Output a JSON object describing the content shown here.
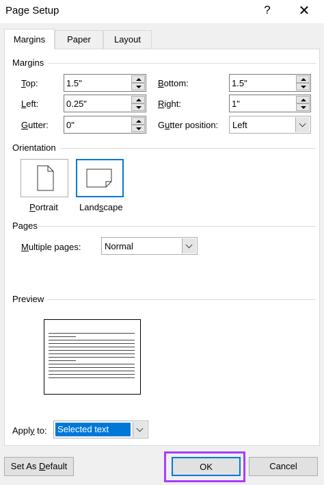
{
  "window": {
    "title": "Page Setup",
    "help": "?",
    "close": "✕"
  },
  "tabs": [
    {
      "label": "Margins",
      "active": true
    },
    {
      "label": "Paper",
      "active": false
    },
    {
      "label": "Layout",
      "active": false
    }
  ],
  "margins": {
    "header": "Margins",
    "top": {
      "label_u": "T",
      "label_rest": "op:",
      "value": "1.5\""
    },
    "left": {
      "label_u": "L",
      "label_rest": "eft:",
      "value": "0.25\""
    },
    "gutter": {
      "label_u": "G",
      "label_rest": "utter:",
      "value": "0\""
    },
    "bottom": {
      "label_u": "B",
      "label_rest": "ottom:",
      "value": "1.5\""
    },
    "right": {
      "label_u": "R",
      "label_rest": "ight:",
      "value": "1\""
    },
    "gutter_position": {
      "label_pre": "G",
      "label_u": "u",
      "label_rest": "tter position:",
      "value": "Left"
    }
  },
  "orientation": {
    "header": "Orientation",
    "portrait": {
      "label_u": "P",
      "label_rest": "ortrait"
    },
    "landscape": {
      "label_pre": "Land",
      "label_u": "s",
      "label_rest": "cape",
      "selected": true
    }
  },
  "pages": {
    "header": "Pages",
    "multiple_pages": {
      "label_u": "M",
      "label_rest": "ultiple pages:",
      "value": "Normal"
    }
  },
  "preview": {
    "header": "Preview"
  },
  "apply_to": {
    "label_pre": "Appl",
    "label_u": "y",
    "label_rest": " to:",
    "value": "Selected text"
  },
  "buttons": {
    "default": {
      "label_pre": "Set As ",
      "label_u": "D",
      "label_rest": "efault"
    },
    "ok": "OK",
    "cancel": "Cancel"
  },
  "colors": {
    "accent": "#0078d7",
    "highlight": "#a93bff",
    "selection": "#0078d7"
  }
}
